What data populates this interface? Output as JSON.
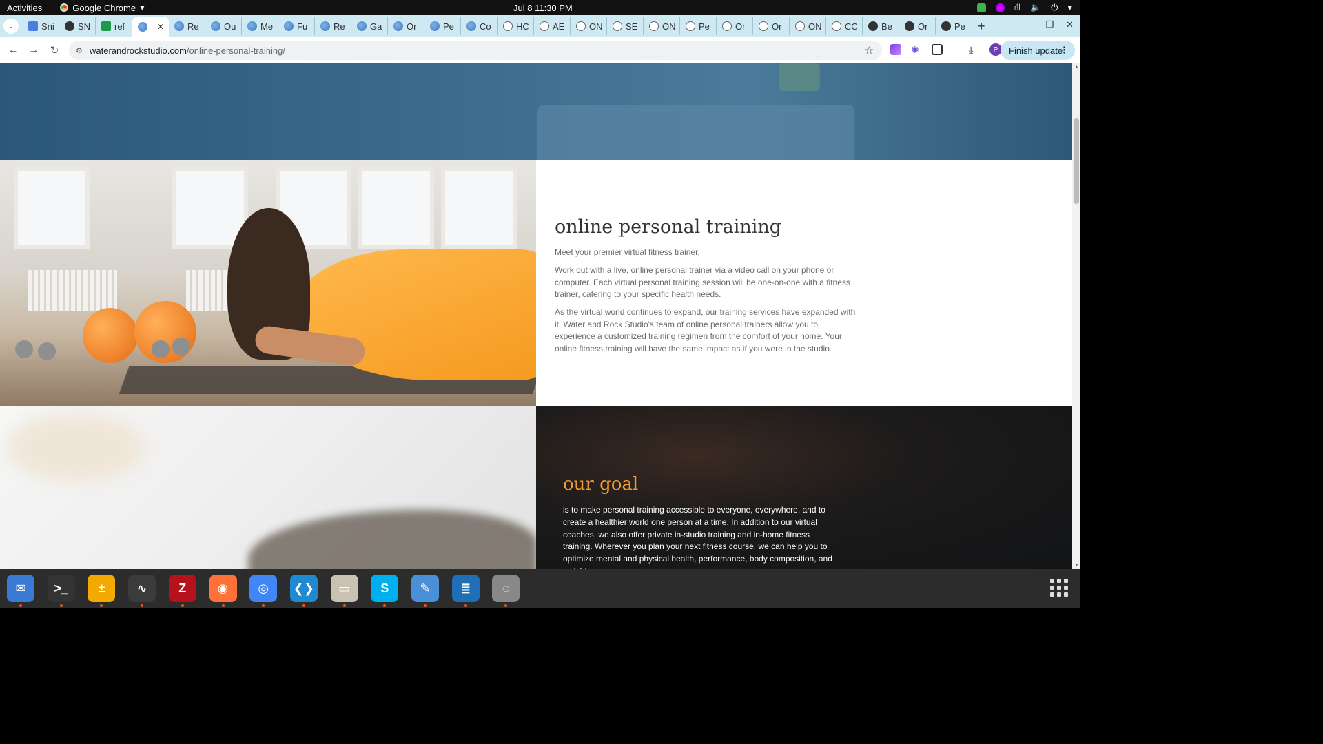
{
  "system": {
    "activities": "Activities",
    "app_name": "Google Chrome",
    "clock": "Jul 8  11:30 PM"
  },
  "tabs": [
    {
      "label": "Sni",
      "icon": "doc-icon"
    },
    {
      "label": "SN",
      "icon": "sn-icon"
    },
    {
      "label": "ref",
      "icon": "sheet-icon"
    },
    {
      "label": "",
      "icon": "globe-icon",
      "active": true
    },
    {
      "label": "Re",
      "icon": "globe-icon"
    },
    {
      "label": "Ou",
      "icon": "globe-icon"
    },
    {
      "label": "Me",
      "icon": "globe-icon"
    },
    {
      "label": "Fu",
      "icon": "globe-icon"
    },
    {
      "label": "Re",
      "icon": "globe-icon"
    },
    {
      "label": "Ga",
      "icon": "globe-icon"
    },
    {
      "label": "Or",
      "icon": "globe-icon"
    },
    {
      "label": "Pe",
      "icon": "globe-icon"
    },
    {
      "label": "Co",
      "icon": "globe-icon"
    },
    {
      "label": "HC",
      "icon": "rk-icon"
    },
    {
      "label": "AE",
      "icon": "rk-icon"
    },
    {
      "label": "ON",
      "icon": "rk-icon"
    },
    {
      "label": "SE",
      "icon": "rk-icon"
    },
    {
      "label": "ON",
      "icon": "rk-icon"
    },
    {
      "label": "Pe",
      "icon": "rk-icon"
    },
    {
      "label": "Or",
      "icon": "rk-icon"
    },
    {
      "label": "Or",
      "icon": "rk-icon"
    },
    {
      "label": "ON",
      "icon": "rk-icon"
    },
    {
      "label": "CC",
      "icon": "rk-icon"
    },
    {
      "label": "Be",
      "icon": "dark-icon"
    },
    {
      "label": "Or",
      "icon": "dark-icon"
    },
    {
      "label": "Pe",
      "icon": "dark-icon"
    }
  ],
  "toolbar": {
    "url_host": "waterandrockstudio.com",
    "url_path": "/online-personal-training/",
    "finish_update": "Finish update",
    "avatar_letter": "P"
  },
  "page": {
    "section1": {
      "title": "online personal training",
      "p1": "Meet your premier virtual fitness trainer.",
      "p2": "Work out with a live, online personal trainer via a video call on your phone or computer. Each virtual personal training session will be one-on-one with a fitness trainer, catering to your specific health needs.",
      "p3": "As the virtual world continues to expand, our training services have expanded with it. Water and Rock Studio's team of online personal trainers allow you to experience a customized training regimen from the comfort of your home. Your online fitness training will have the same impact as if you were in the studio."
    },
    "section2": {
      "title": "our goal",
      "p1": "is to make personal training accessible to everyone, everywhere, and to create a healthier world one person at a time. In addition to our virtual coaches, we also offer private in-studio training and in-home fitness training. Wherever you plan your next fitness course, we can help you to optimize mental and physical health, performance, body composition, and weight"
    }
  },
  "dock": [
    {
      "name": "thunderbird-icon",
      "color": "#3a7bd5"
    },
    {
      "name": "terminal-icon",
      "color": "#333333"
    },
    {
      "name": "calculator-icon",
      "color": "#f2a900"
    },
    {
      "name": "system-monitor-icon",
      "color": "#3b3b3b"
    },
    {
      "name": "filezilla-icon",
      "color": "#b5121b"
    },
    {
      "name": "firefox-icon",
      "color": "#ff7139"
    },
    {
      "name": "chrome-icon",
      "color": "#4285f4"
    },
    {
      "name": "vscode-icon",
      "color": "#1f8ad2"
    },
    {
      "name": "files-icon",
      "color": "#c9c2b3"
    },
    {
      "name": "skype-icon",
      "color": "#00aff0"
    },
    {
      "name": "text-editor-icon",
      "color": "#4a90d9"
    },
    {
      "name": "writer-icon",
      "color": "#1e6fb8"
    },
    {
      "name": "disk-icon",
      "color": "#888888"
    }
  ]
}
